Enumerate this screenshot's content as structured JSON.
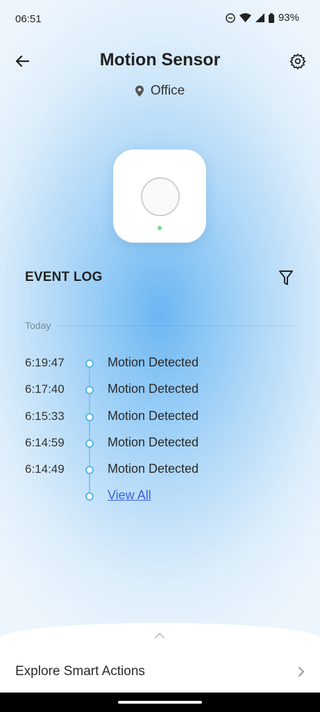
{
  "status_bar": {
    "time": "06:51",
    "battery": "93%"
  },
  "header": {
    "title": "Motion Sensor",
    "location": "Office"
  },
  "event_log": {
    "title": "EVENT LOG",
    "date_group": "Today",
    "events": [
      {
        "time": "6:19:47",
        "text": "Motion Detected"
      },
      {
        "time": "6:17:40",
        "text": "Motion Detected"
      },
      {
        "time": "6:15:33",
        "text": "Motion Detected"
      },
      {
        "time": "6:14:59",
        "text": "Motion Detected"
      },
      {
        "time": "6:14:49",
        "text": "Motion Detected"
      }
    ],
    "view_all": "View All"
  },
  "bottom_sheet": {
    "label": "Explore Smart Actions"
  },
  "colors": {
    "accent": "#56b6ea",
    "link": "#3b5fd8",
    "led": "#6fdc8a"
  }
}
